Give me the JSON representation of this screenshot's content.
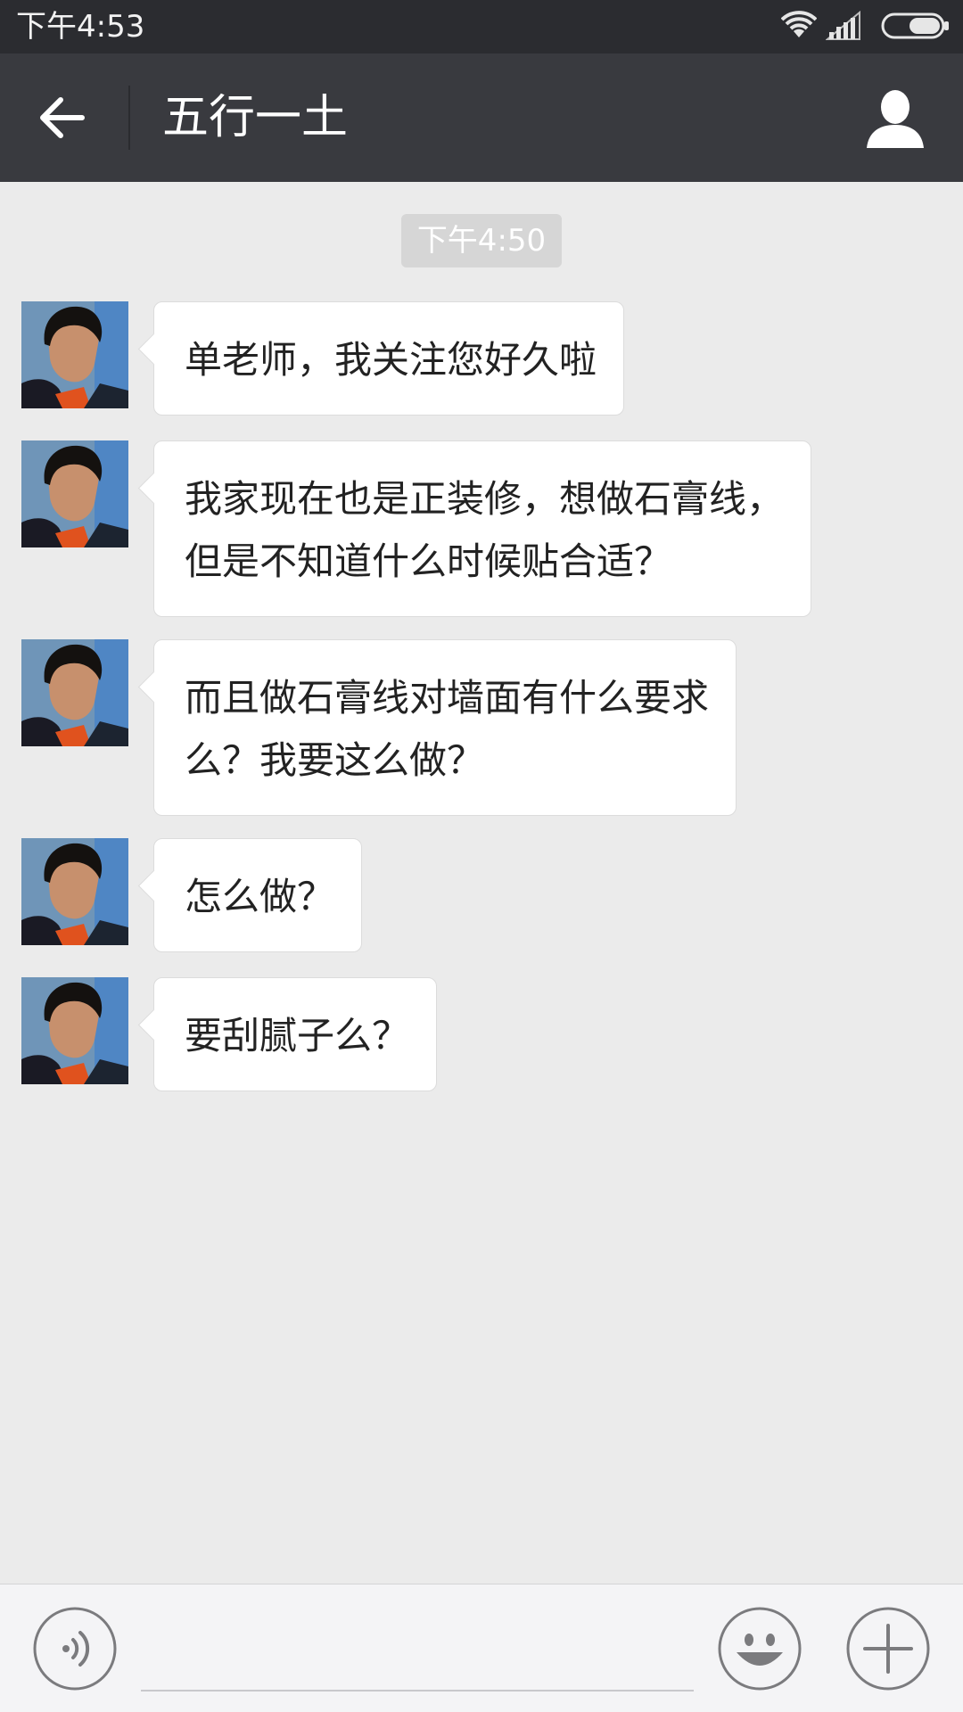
{
  "status_bar": {
    "time": "下午4:53",
    "icons": [
      "wifi-icon",
      "signal-icon",
      "battery-icon"
    ]
  },
  "header": {
    "title": "五行一土",
    "back_icon": "back-arrow-icon",
    "profile_icon": "person-icon"
  },
  "chat": {
    "timestamp": "下午4:50",
    "messages": [
      {
        "sender": "incoming",
        "text": "单老师，我关注您好久啦"
      },
      {
        "sender": "incoming",
        "text": "我家现在也是正装修，想做石膏线，\n但是不知道什么时候贴合适？"
      },
      {
        "sender": "incoming",
        "text": "而且做石膏线对墙面有什么要求\n么？我要这么做？"
      },
      {
        "sender": "incoming",
        "text": "怎么做？"
      },
      {
        "sender": "incoming",
        "text": "要刮腻子么？"
      }
    ]
  },
  "input_bar": {
    "text_value": "",
    "icons": [
      "voice-icon",
      "emoji-icon",
      "plus-icon"
    ]
  },
  "colors": {
    "status_bar_bg": "#2b2c30",
    "title_bar_bg": "#393a3f",
    "chat_bg": "#ebebeb",
    "bubble_bg": "#ffffff",
    "timestamp_bg": "#d6d6d6",
    "input_bar_bg": "#f4f4f6"
  }
}
